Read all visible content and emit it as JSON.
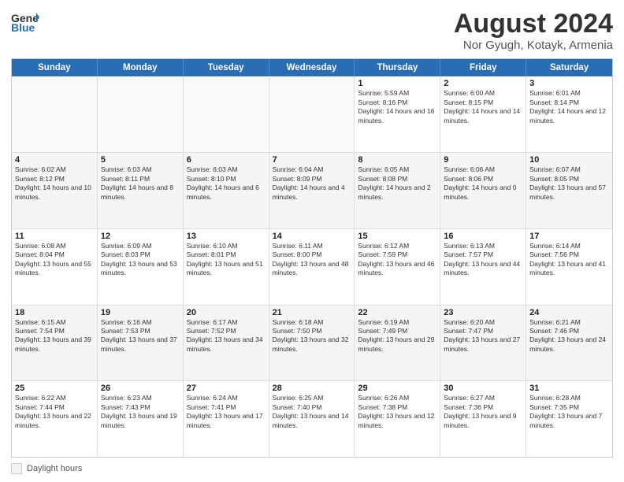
{
  "logo": {
    "general": "General",
    "blue": "Blue"
  },
  "title": "August 2024",
  "subtitle": "Nor Gyugh, Kotayk, Armenia",
  "days_of_week": [
    "Sunday",
    "Monday",
    "Tuesday",
    "Wednesday",
    "Thursday",
    "Friday",
    "Saturday"
  ],
  "weeks": [
    [
      {
        "day": "",
        "info": ""
      },
      {
        "day": "",
        "info": ""
      },
      {
        "day": "",
        "info": ""
      },
      {
        "day": "",
        "info": ""
      },
      {
        "day": "1",
        "info": "Sunrise: 5:59 AM\nSunset: 8:16 PM\nDaylight: 14 hours and 16 minutes."
      },
      {
        "day": "2",
        "info": "Sunrise: 6:00 AM\nSunset: 8:15 PM\nDaylight: 14 hours and 14 minutes."
      },
      {
        "day": "3",
        "info": "Sunrise: 6:01 AM\nSunset: 8:14 PM\nDaylight: 14 hours and 12 minutes."
      }
    ],
    [
      {
        "day": "4",
        "info": "Sunrise: 6:02 AM\nSunset: 8:12 PM\nDaylight: 14 hours and 10 minutes."
      },
      {
        "day": "5",
        "info": "Sunrise: 6:03 AM\nSunset: 8:11 PM\nDaylight: 14 hours and 8 minutes."
      },
      {
        "day": "6",
        "info": "Sunrise: 6:03 AM\nSunset: 8:10 PM\nDaylight: 14 hours and 6 minutes."
      },
      {
        "day": "7",
        "info": "Sunrise: 6:04 AM\nSunset: 8:09 PM\nDaylight: 14 hours and 4 minutes."
      },
      {
        "day": "8",
        "info": "Sunrise: 6:05 AM\nSunset: 8:08 PM\nDaylight: 14 hours and 2 minutes."
      },
      {
        "day": "9",
        "info": "Sunrise: 6:06 AM\nSunset: 8:06 PM\nDaylight: 14 hours and 0 minutes."
      },
      {
        "day": "10",
        "info": "Sunrise: 6:07 AM\nSunset: 8:05 PM\nDaylight: 13 hours and 57 minutes."
      }
    ],
    [
      {
        "day": "11",
        "info": "Sunrise: 6:08 AM\nSunset: 8:04 PM\nDaylight: 13 hours and 55 minutes."
      },
      {
        "day": "12",
        "info": "Sunrise: 6:09 AM\nSunset: 8:03 PM\nDaylight: 13 hours and 53 minutes."
      },
      {
        "day": "13",
        "info": "Sunrise: 6:10 AM\nSunset: 8:01 PM\nDaylight: 13 hours and 51 minutes."
      },
      {
        "day": "14",
        "info": "Sunrise: 6:11 AM\nSunset: 8:00 PM\nDaylight: 13 hours and 48 minutes."
      },
      {
        "day": "15",
        "info": "Sunrise: 6:12 AM\nSunset: 7:59 PM\nDaylight: 13 hours and 46 minutes."
      },
      {
        "day": "16",
        "info": "Sunrise: 6:13 AM\nSunset: 7:57 PM\nDaylight: 13 hours and 44 minutes."
      },
      {
        "day": "17",
        "info": "Sunrise: 6:14 AM\nSunset: 7:56 PM\nDaylight: 13 hours and 41 minutes."
      }
    ],
    [
      {
        "day": "18",
        "info": "Sunrise: 6:15 AM\nSunset: 7:54 PM\nDaylight: 13 hours and 39 minutes."
      },
      {
        "day": "19",
        "info": "Sunrise: 6:16 AM\nSunset: 7:53 PM\nDaylight: 13 hours and 37 minutes."
      },
      {
        "day": "20",
        "info": "Sunrise: 6:17 AM\nSunset: 7:52 PM\nDaylight: 13 hours and 34 minutes."
      },
      {
        "day": "21",
        "info": "Sunrise: 6:18 AM\nSunset: 7:50 PM\nDaylight: 13 hours and 32 minutes."
      },
      {
        "day": "22",
        "info": "Sunrise: 6:19 AM\nSunset: 7:49 PM\nDaylight: 13 hours and 29 minutes."
      },
      {
        "day": "23",
        "info": "Sunrise: 6:20 AM\nSunset: 7:47 PM\nDaylight: 13 hours and 27 minutes."
      },
      {
        "day": "24",
        "info": "Sunrise: 6:21 AM\nSunset: 7:46 PM\nDaylight: 13 hours and 24 minutes."
      }
    ],
    [
      {
        "day": "25",
        "info": "Sunrise: 6:22 AM\nSunset: 7:44 PM\nDaylight: 13 hours and 22 minutes."
      },
      {
        "day": "26",
        "info": "Sunrise: 6:23 AM\nSunset: 7:43 PM\nDaylight: 13 hours and 19 minutes."
      },
      {
        "day": "27",
        "info": "Sunrise: 6:24 AM\nSunset: 7:41 PM\nDaylight: 13 hours and 17 minutes."
      },
      {
        "day": "28",
        "info": "Sunrise: 6:25 AM\nSunset: 7:40 PM\nDaylight: 13 hours and 14 minutes."
      },
      {
        "day": "29",
        "info": "Sunrise: 6:26 AM\nSunset: 7:38 PM\nDaylight: 13 hours and 12 minutes."
      },
      {
        "day": "30",
        "info": "Sunrise: 6:27 AM\nSunset: 7:36 PM\nDaylight: 13 hours and 9 minutes."
      },
      {
        "day": "31",
        "info": "Sunrise: 6:28 AM\nSunset: 7:35 PM\nDaylight: 13 hours and 7 minutes."
      }
    ]
  ],
  "legend": {
    "label": "Daylight hours"
  }
}
